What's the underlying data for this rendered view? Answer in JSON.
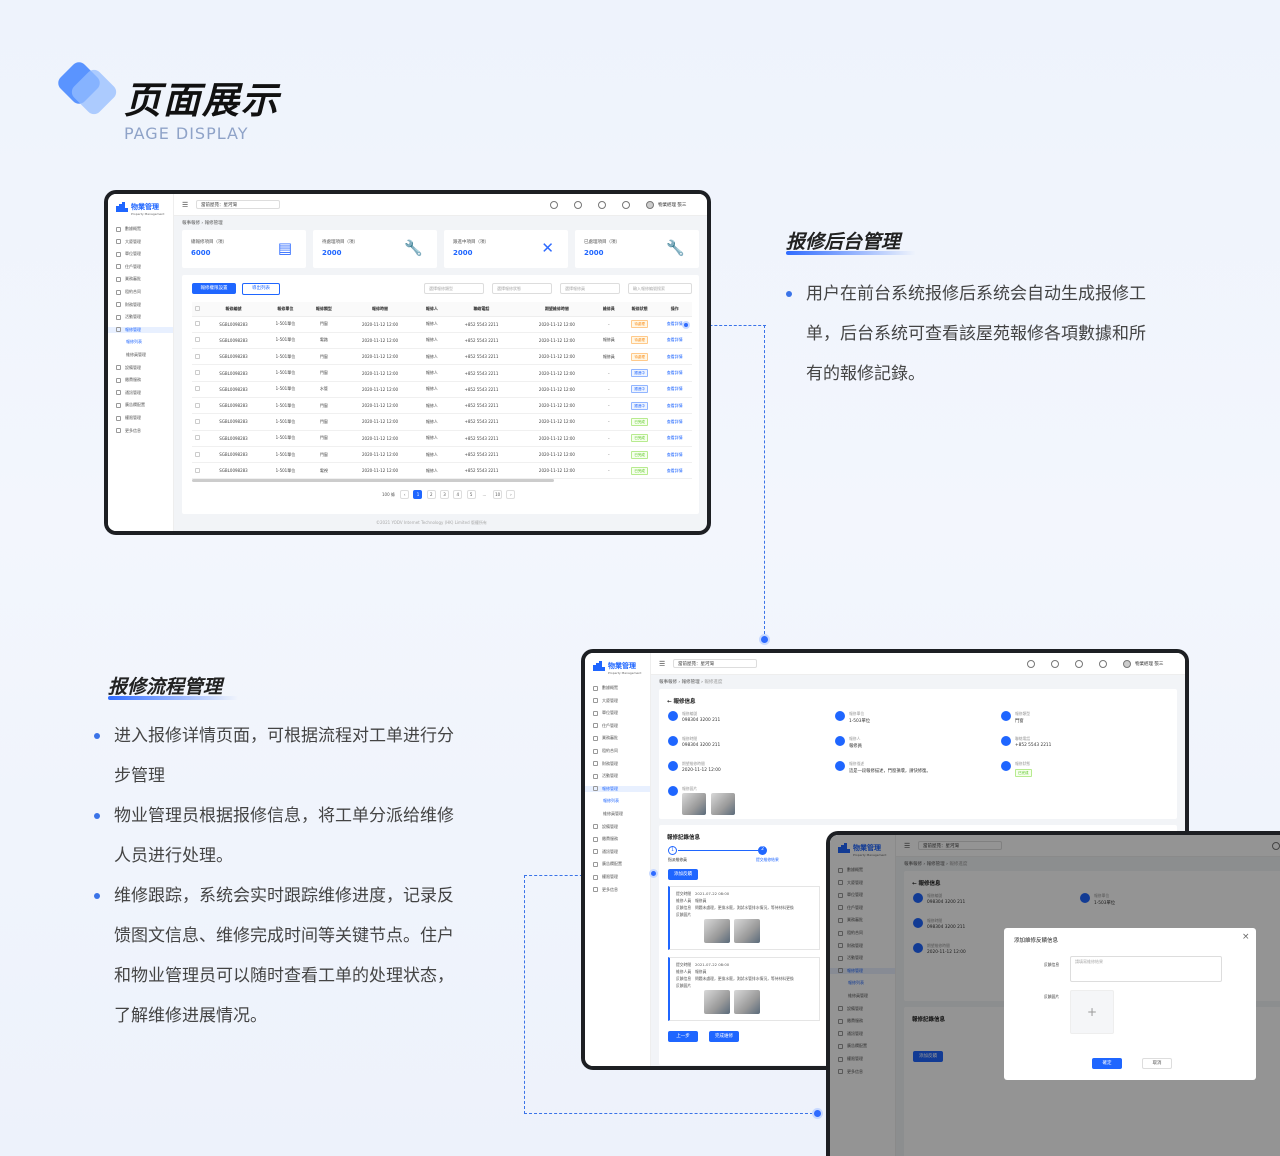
{
  "header": {
    "title": "页面展示",
    "subtitle": "PAGE DISPLAY",
    "colors": {
      "accent": "#2f6bff",
      "brand": "#1f66ff"
    }
  },
  "section1": {
    "title": "报修后台管理",
    "desc": "用户在前台系统报修后系统会自动生成报修工单，后台系统可查看該屋苑報修各項數據和所有的報修記錄。",
    "desc_lines": [
      "用户在前台系统报修后系统会自动生成报修工",
      "单，后台系统可查看該屋苑報修各項數據和所",
      "有的報修記錄。"
    ]
  },
  "section2": {
    "title": "报修流程管理",
    "bullets": [
      {
        "lines": [
          "进入报修详情页面，可根据流程对工单进行分",
          "步管理"
        ]
      },
      {
        "lines": [
          "物业管理员根据报修信息，将工单分派给维修",
          "人员进行处理。"
        ]
      },
      {
        "lines": [
          "维修跟踪，系统会实时跟踪维修进度，记录反",
          "馈图文信息、维修完成时间等关键节点。住户",
          "和物业管理员可以随时查看工单的处理状态，",
          "了解维修进展情况。"
        ]
      }
    ]
  },
  "app": {
    "brand": "物業管理",
    "brand_sub": "Property Management",
    "estate_select": "當前屋苑：星河灣",
    "user": "物業經理 張三",
    "menu": [
      "數據概覽",
      "大廈管理",
      "單位管理",
      "住戶管理",
      "業務審批",
      "租約合同",
      "財務管理",
      "活動管理",
      "報修管理",
      "報修列表",
      "維修員管理",
      "設備管理",
      "繳費服務",
      "通訊管理",
      "廣告欄配置",
      "權限管理",
      "更多信息"
    ],
    "icons": [
      "menu-fold-icon",
      "bell-icon",
      "screen-icon",
      "tree-icon",
      "globe-icon",
      "avatar",
      "chevron-down-icon"
    ]
  },
  "list_page": {
    "breadcrumb": [
      "報事報修",
      "報修管理"
    ],
    "stats": [
      {
        "label": "總報修項目（項）",
        "value": "6000"
      },
      {
        "label": "待處理項目（項）",
        "value": "2000"
      },
      {
        "label": "跟進中項目（項）",
        "value": "2000"
      },
      {
        "label": "已處理項目（項）",
        "value": "2000"
      }
    ],
    "btn_settings": "報修權限設置",
    "btn_export": "導出列表",
    "filters": [
      "選擇報修類型",
      "選擇報修狀態",
      "選擇報修員",
      "輸入報修編號搜索"
    ],
    "columns": [
      "報修編號",
      "報修單位",
      "報修類型",
      "報修時間",
      "報修人",
      "聯絡電話",
      "期望維修時間",
      "維修員",
      "報修狀態",
      "操作"
    ],
    "rows": [
      [
        "SGBL0098283",
        "1-501單位",
        "門窗",
        "2020-11-12 12:00",
        "報修人",
        "+852 5543 2211",
        "2020-11-12 12:00",
        "-",
        "待處理",
        "查看詳情"
      ],
      [
        "SGBL0098283",
        "1-501單位",
        "電路",
        "2020-11-12 12:00",
        "報修人",
        "+852 5543 2211",
        "2020-11-12 12:00",
        "報修員",
        "待處理",
        "查看詳情"
      ],
      [
        "SGBL0098283",
        "1-501單位",
        "門窗",
        "2020-11-12 12:00",
        "報修人",
        "+852 5543 2211",
        "2020-11-12 12:00",
        "報修員",
        "待處理",
        "查看詳情"
      ],
      [
        "SGBL0098283",
        "1-501單位",
        "門窗",
        "2020-11-12 12:00",
        "報修人",
        "+852 5543 2211",
        "2020-11-12 12:00",
        "-",
        "跟進中",
        "查看詳情"
      ],
      [
        "SGBL0098283",
        "1-501單位",
        "水管",
        "2020-11-12 12:00",
        "報修人",
        "+852 5543 2211",
        "2020-11-12 12:00",
        "-",
        "跟進中",
        "查看詳情"
      ],
      [
        "SGBL0098283",
        "1-501單位",
        "門窗",
        "2020-11-12 12:00",
        "報修人",
        "+852 5543 2211",
        "2020-11-12 12:00",
        "-",
        "跟進中",
        "查看詳情"
      ],
      [
        "SGBL0098283",
        "1-501單位",
        "門窗",
        "2020-11-12 12:00",
        "報修人",
        "+852 5543 2211",
        "2020-11-12 12:00",
        "-",
        "已完成",
        "查看詳情"
      ],
      [
        "SGBL0098283",
        "1-501單位",
        "門窗",
        "2020-11-12 12:00",
        "報修人",
        "+852 5543 2211",
        "2020-11-12 12:00",
        "-",
        "已完成",
        "查看詳情"
      ],
      [
        "SGBL0098283",
        "1-501單位",
        "門窗",
        "2020-11-12 12:00",
        "報修人",
        "+852 5543 2211",
        "2020-11-12 12:00",
        "-",
        "已完成",
        "查看詳情"
      ],
      [
        "SGBL0098283",
        "1-501單位",
        "電視",
        "2020-11-12 12:00",
        "報修人",
        "+852 5543 2211",
        "2020-11-12 12:00",
        "-",
        "已完成",
        "查看詳情"
      ]
    ],
    "status_colors": {
      "待處理": "o",
      "跟進中": "b",
      "已完成": "g"
    },
    "pager": {
      "size": "100 條",
      "pages": [
        "1",
        "2",
        "3",
        "4",
        "5",
        "...",
        "10"
      ]
    },
    "footer": "©2021 YODV Internet Technology (HK) Limited  版權所有"
  },
  "detail_page": {
    "breadcrumb": [
      "報事報修",
      "報修管理",
      "報修進度"
    ],
    "section_info": "報修信息",
    "fields": [
      {
        "label": "報修編號",
        "value": "098304 3200 211"
      },
      {
        "label": "報修單位",
        "value": "1-503單位"
      },
      {
        "label": "報修類型",
        "value": "門窗"
      },
      {
        "label": "報修時間",
        "value": "098304 3200 211"
      },
      {
        "label": "報修人",
        "value": "報修員"
      },
      {
        "label": "聯絡電話",
        "value": "+852 5543 2211"
      },
      {
        "label": "期望維修時間",
        "value": "2020-11-12 12:00"
      },
      {
        "label": "報修描述",
        "value": "這是一段報修描述，門窗損壞，請快修復。"
      },
      {
        "label": "報修狀態",
        "value": "已完成"
      },
      {
        "label": "報修圖片",
        "value": ""
      }
    ],
    "section_record": "報修記錄信息",
    "steps": [
      "指派維修員",
      "提交維修結果"
    ],
    "add_feedback": "添加反饋",
    "records": [
      {
        "time_label": "提交時間",
        "time": "2021-07-22 08:00",
        "worker_label": "維修人員",
        "worker": "報修員",
        "info_label": "反饋信息",
        "info": "問題未處理，更換水龍，測試水管排水情況，等待材料更換",
        "photos_label": "反饋圖片"
      },
      {
        "time_label": "提交時間",
        "time": "2021-07-22 08:00",
        "worker_label": "維修人員",
        "worker": "報修員",
        "info_label": "反饋信息",
        "info": "問題未處理，更換水龍，測試水管排水情況，等待材料更換",
        "photos_label": "反饋圖片"
      }
    ],
    "btn_prev": "上一步",
    "btn_done": "完成維修"
  },
  "modal": {
    "title": "添加維修反饋信息",
    "feedback_label": "反饋信息",
    "feedback_placeholder": "請填寫維修結果",
    "photo_label": "反饋圖片",
    "confirm": "確定",
    "cancel": "取消"
  }
}
